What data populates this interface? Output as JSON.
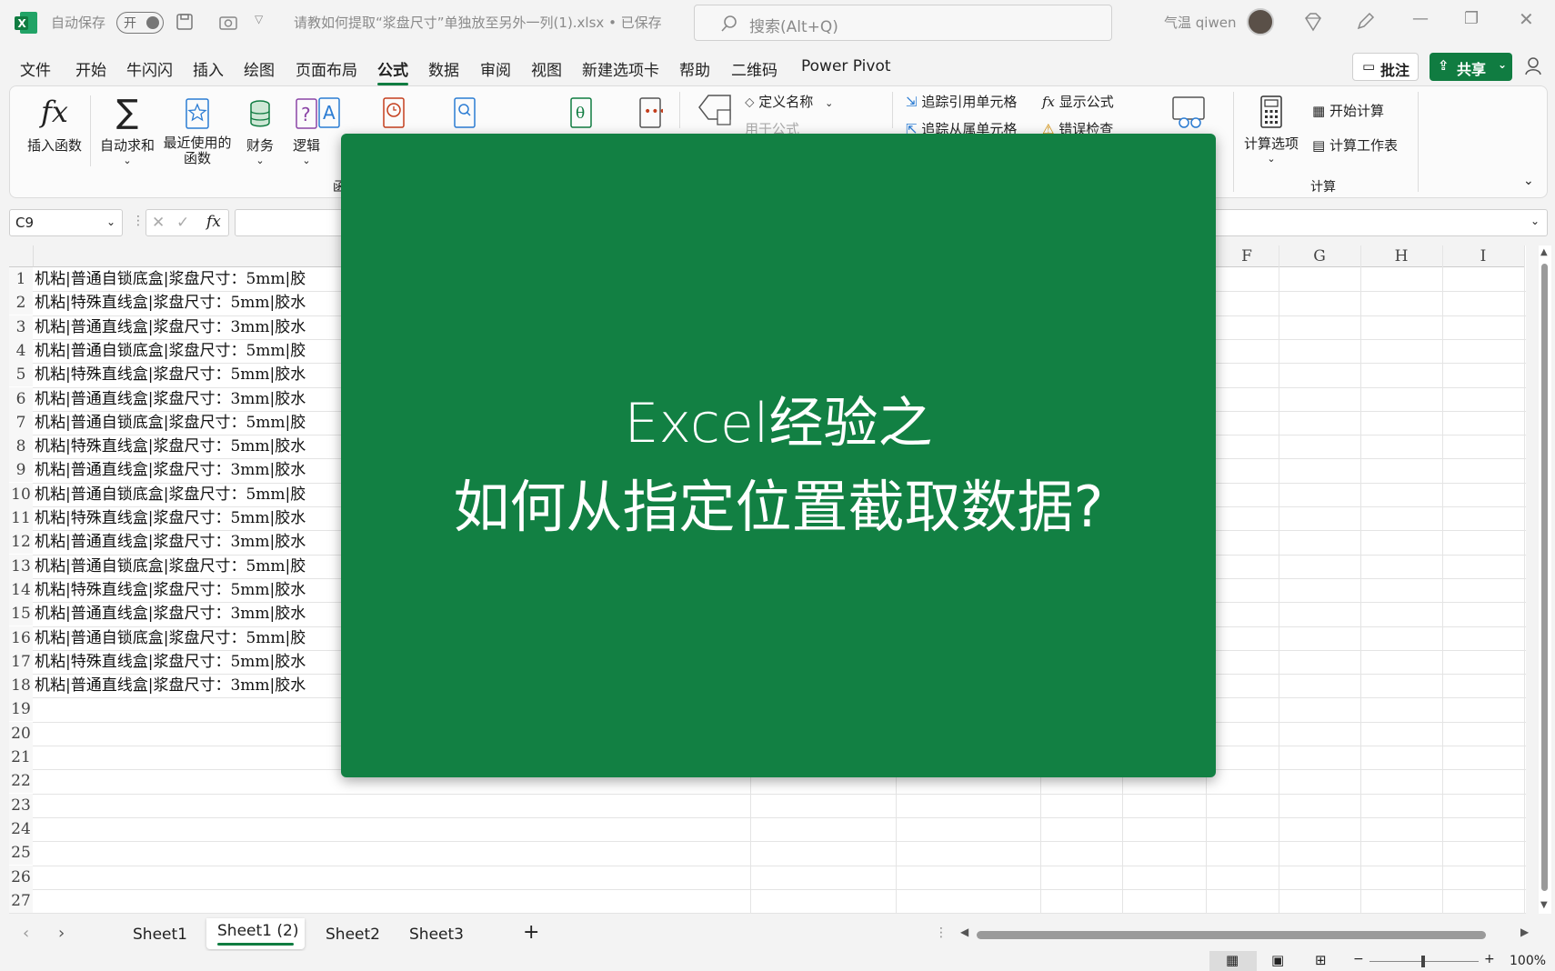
{
  "titlebar": {
    "autosave_label": "自动保存",
    "autosave_state": "开",
    "filename": "请教如何提取“浆盘尺寸”单独放至另外一列(1).xlsx • 已保存",
    "search_placeholder": "搜索(Alt+Q)",
    "user_name": "气温 qiwen"
  },
  "menu": {
    "tabs": [
      "文件",
      "开始",
      "牛闪闪",
      "插入",
      "绘图",
      "页面布局",
      "公式",
      "数据",
      "审阅",
      "视图",
      "新建选项卡",
      "帮助",
      "二维码",
      "Power Pivot"
    ],
    "active": "公式",
    "comment_label": "批注",
    "share_label": "共享"
  },
  "ribbon": {
    "insert_function": "插入函数",
    "autosum": "自动求和",
    "recent_line1": "最近使用的",
    "recent_line2": "函数",
    "financial": "财务",
    "logical": "逻辑",
    "group_function": "函",
    "define_name": "定义名称",
    "use_in_formula": "用于公式",
    "trace_precedents": "追踪引用单元格",
    "trace_dependents": "追踪从属单元格",
    "show_formulas": "显示公式",
    "error_checking": "错误检查",
    "calc_options": "计算选项",
    "calc_now": "开始计算",
    "calc_sheet": "计算工作表",
    "group_calc": "计算"
  },
  "formula_bar": {
    "name_box": "C9",
    "fx": "fx"
  },
  "grid": {
    "columns_visible": [
      "F",
      "G",
      "H",
      "I"
    ],
    "row_numbers": [
      "1",
      "2",
      "3",
      "4",
      "5",
      "6",
      "7",
      "8",
      "9",
      "10",
      "11",
      "12",
      "13",
      "14",
      "15",
      "16",
      "17",
      "18",
      "19",
      "20",
      "21",
      "22",
      "23",
      "24",
      "25",
      "26",
      "27"
    ],
    "rows": [
      "机粘|普通自锁底盒|浆盘尺寸：5mm|胶",
      "机粘|特殊直线盒|浆盘尺寸：5mm|胶水",
      "机粘|普通直线盒|浆盘尺寸：3mm|胶水",
      "机粘|普通自锁底盒|浆盘尺寸：5mm|胶",
      "机粘|特殊直线盒|浆盘尺寸：5mm|胶水",
      "机粘|普通直线盒|浆盘尺寸：3mm|胶水",
      "机粘|普通自锁底盒|浆盘尺寸：5mm|胶",
      "机粘|特殊直线盒|浆盘尺寸：5mm|胶水",
      "机粘|普通直线盒|浆盘尺寸：3mm|胶水",
      "机粘|普通自锁底盒|浆盘尺寸：5mm|胶",
      "机粘|特殊直线盒|浆盘尺寸：5mm|胶水",
      "机粘|普通直线盒|浆盘尺寸：3mm|胶水",
      "机粘|普通自锁底盒|浆盘尺寸：5mm|胶",
      "机粘|特殊直线盒|浆盘尺寸：5mm|胶水",
      "机粘|普通直线盒|浆盘尺寸：3mm|胶水",
      "机粘|普通自锁底盒|浆盘尺寸：5mm|胶",
      "机粘|特殊直线盒|浆盘尺寸：5mm|胶水",
      "机粘|普通直线盒|浆盘尺寸：3mm|胶水"
    ]
  },
  "overlay": {
    "line1": "Excel经验之",
    "line2": "如何从指定位置截取数据?"
  },
  "sheets": {
    "tabs": [
      "Sheet1",
      "Sheet1 (2)",
      "Sheet2",
      "Sheet3"
    ],
    "active": "Sheet1 (2)",
    "add": "+"
  },
  "status": {
    "zoom": "100%"
  },
  "colors": {
    "excel_green": "#107c41",
    "overlay_green": "#128043"
  }
}
